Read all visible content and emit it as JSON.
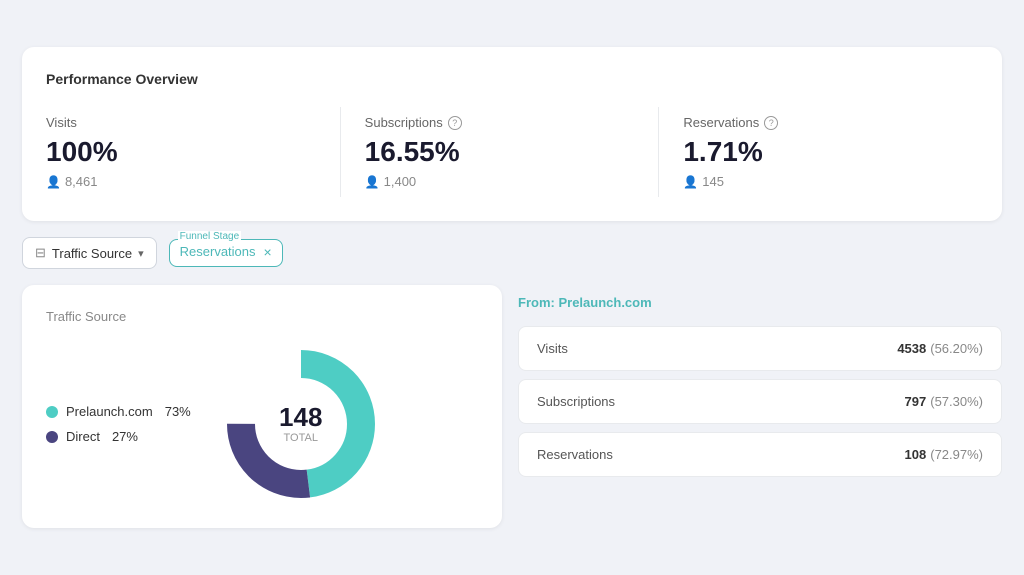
{
  "page": {
    "performance_title": "Performance Overview",
    "metrics": [
      {
        "label": "Visits",
        "has_help": false,
        "value": "100%",
        "sub": "8,461"
      },
      {
        "label": "Subscriptions",
        "has_help": true,
        "value": "16.55%",
        "sub": "1,400"
      },
      {
        "label": "Reservations",
        "has_help": true,
        "value": "1.71%",
        "sub": "145"
      }
    ],
    "filters": {
      "traffic_source_label": "Traffic Source",
      "funnel_stage_label": "Funnel Stage",
      "funnel_stage_value": "Reservations"
    },
    "traffic_chart": {
      "title": "Traffic Source",
      "segments": [
        {
          "label": "Prelaunch.com",
          "pct": 73,
          "color": "#4ecdc4"
        },
        {
          "label": "Direct",
          "pct": 27,
          "color": "#4a4580"
        }
      ],
      "total": "148",
      "total_label": "TOTAL"
    },
    "stats": {
      "from_label": "From:",
      "from_source": "Prelaunch.com",
      "rows": [
        {
          "label": "Visits",
          "value": "4538",
          "pct": "(56.20%)"
        },
        {
          "label": "Subscriptions",
          "value": "797",
          "pct": "(57.30%)"
        },
        {
          "label": "Reservations",
          "value": "108",
          "pct": "(72.97%)"
        }
      ]
    },
    "help_icon_char": "?",
    "chevron_char": "▾",
    "close_char": "×"
  }
}
